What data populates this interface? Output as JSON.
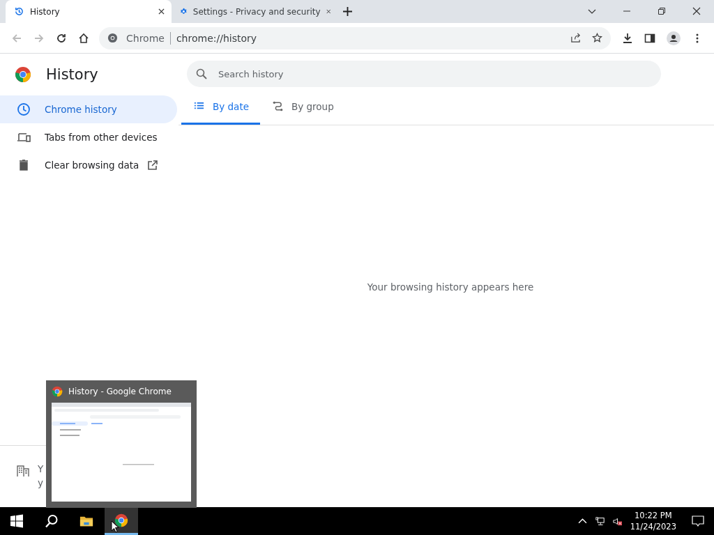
{
  "tabs": [
    {
      "title": "History",
      "selected": true
    },
    {
      "title": "Settings - Privacy and security",
      "selected": false
    }
  ],
  "address_bar": {
    "site_label": "Chrome",
    "url": "chrome://history"
  },
  "page": {
    "title": "History",
    "search": {
      "placeholder": "Search history"
    },
    "sidebar": [
      {
        "label": "Chrome history",
        "selected": true,
        "external": false
      },
      {
        "label": "Tabs from other devices",
        "selected": false,
        "external": false
      },
      {
        "label": "Clear browsing data",
        "selected": false,
        "external": true
      }
    ],
    "view_tabs": [
      {
        "label": "By date",
        "selected": true
      },
      {
        "label": "By group",
        "selected": false
      }
    ],
    "empty_message": "Your browsing history appears here",
    "footer_lines": [
      "Y",
      "y"
    ]
  },
  "taskbar": {
    "items": [
      {
        "kind": "start",
        "active": false
      },
      {
        "kind": "search",
        "active": false
      },
      {
        "kind": "explorer",
        "active": false
      },
      {
        "kind": "chrome",
        "active": true
      }
    ],
    "preview": {
      "title": "History - Google Chrome"
    },
    "time": "10:22 PM",
    "date": "11/24/2023"
  }
}
